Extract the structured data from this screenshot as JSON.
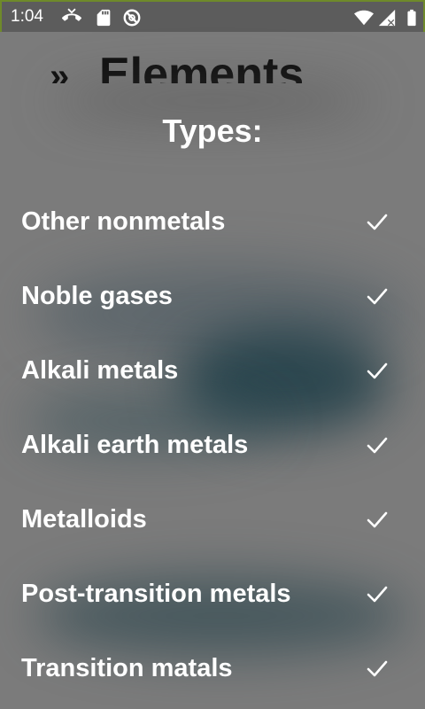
{
  "status_bar": {
    "time": "1:04",
    "icons": [
      "missed-call-icon",
      "sd-card-icon",
      "do-not-disturb-icon",
      "wifi-icon",
      "signal-no-data-icon",
      "battery-icon"
    ]
  },
  "background": {
    "chevron": "»",
    "title": "Elements"
  },
  "menu": {
    "heading": "Types:",
    "items": [
      {
        "label": "Other nonmetals",
        "checked": true
      },
      {
        "label": "Noble gases",
        "checked": true
      },
      {
        "label": "Alkali metals",
        "checked": true
      },
      {
        "label": "Alkali earth metals",
        "checked": true
      },
      {
        "label": "Metalloids",
        "checked": true
      },
      {
        "label": "Post-transition metals",
        "checked": true
      },
      {
        "label": "Transition matals",
        "checked": true
      }
    ]
  },
  "colors": {
    "overlay": "#7b7b7b",
    "status_bar": "#5c5c5c",
    "text": "#ffffff",
    "dark_blob": "#1c3a44"
  }
}
